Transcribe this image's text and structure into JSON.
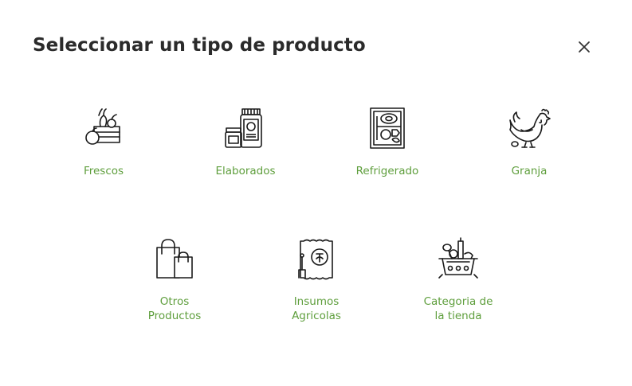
{
  "modal": {
    "title": "Seleccionar un tipo de producto",
    "close_icon": "close-icon"
  },
  "colors": {
    "accent": "#5e9e3c",
    "title": "#2b2b2b",
    "icon_stroke": "#1a1a1a"
  },
  "options": [
    {
      "label": "Frescos",
      "icon": "fresh-produce-crate-icon"
    },
    {
      "label": "Elaborados",
      "icon": "jars-icon"
    },
    {
      "label": "Refrigerado",
      "icon": "refrigerator-icon"
    },
    {
      "label": "Granja",
      "icon": "rooster-icon"
    },
    {
      "label": "Otros\nProductos",
      "icon": "shopping-bags-icon"
    },
    {
      "label": "Insumos\nAgricolas",
      "icon": "seed-sack-icon"
    },
    {
      "label": "Categoria de\nla tienda",
      "icon": "basket-icon"
    }
  ]
}
